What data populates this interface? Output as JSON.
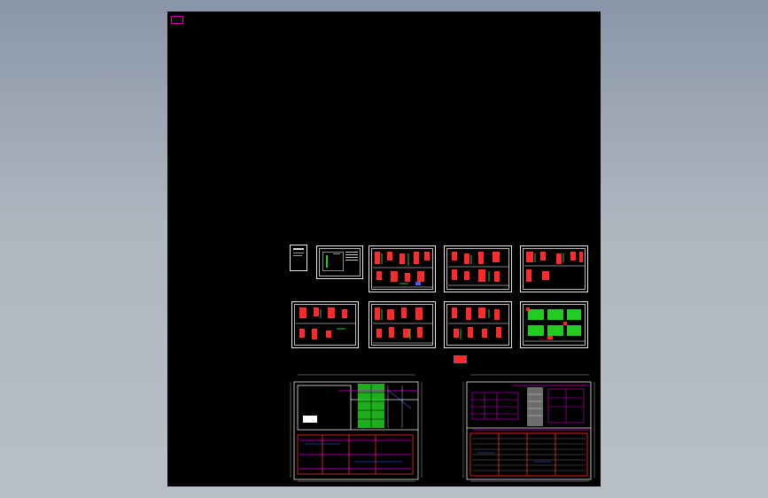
{
  "viewport": {
    "background": "gradient-grey-blue",
    "canvas_color": "#000000"
  },
  "drawing": {
    "ucs_icon": "ucs-icon",
    "sheets_row1": [
      "cover-sheet",
      "notes-sheet",
      "detail-sheet-1",
      "detail-sheet-2",
      "detail-sheet-3"
    ],
    "sheets_row2": [
      "detail-sheet-4",
      "detail-sheet-5",
      "detail-sheet-6",
      "schedule-sheet-green"
    ],
    "plans": [
      "floor-plan-left",
      "floor-plan-right"
    ],
    "colors": {
      "frame": "#e8e8e8",
      "red": "#ff2a2a",
      "magenta": "#d100d1",
      "green": "#22cc22",
      "white": "#ffffff",
      "blue": "#4060ff",
      "gray": "#888888"
    }
  }
}
